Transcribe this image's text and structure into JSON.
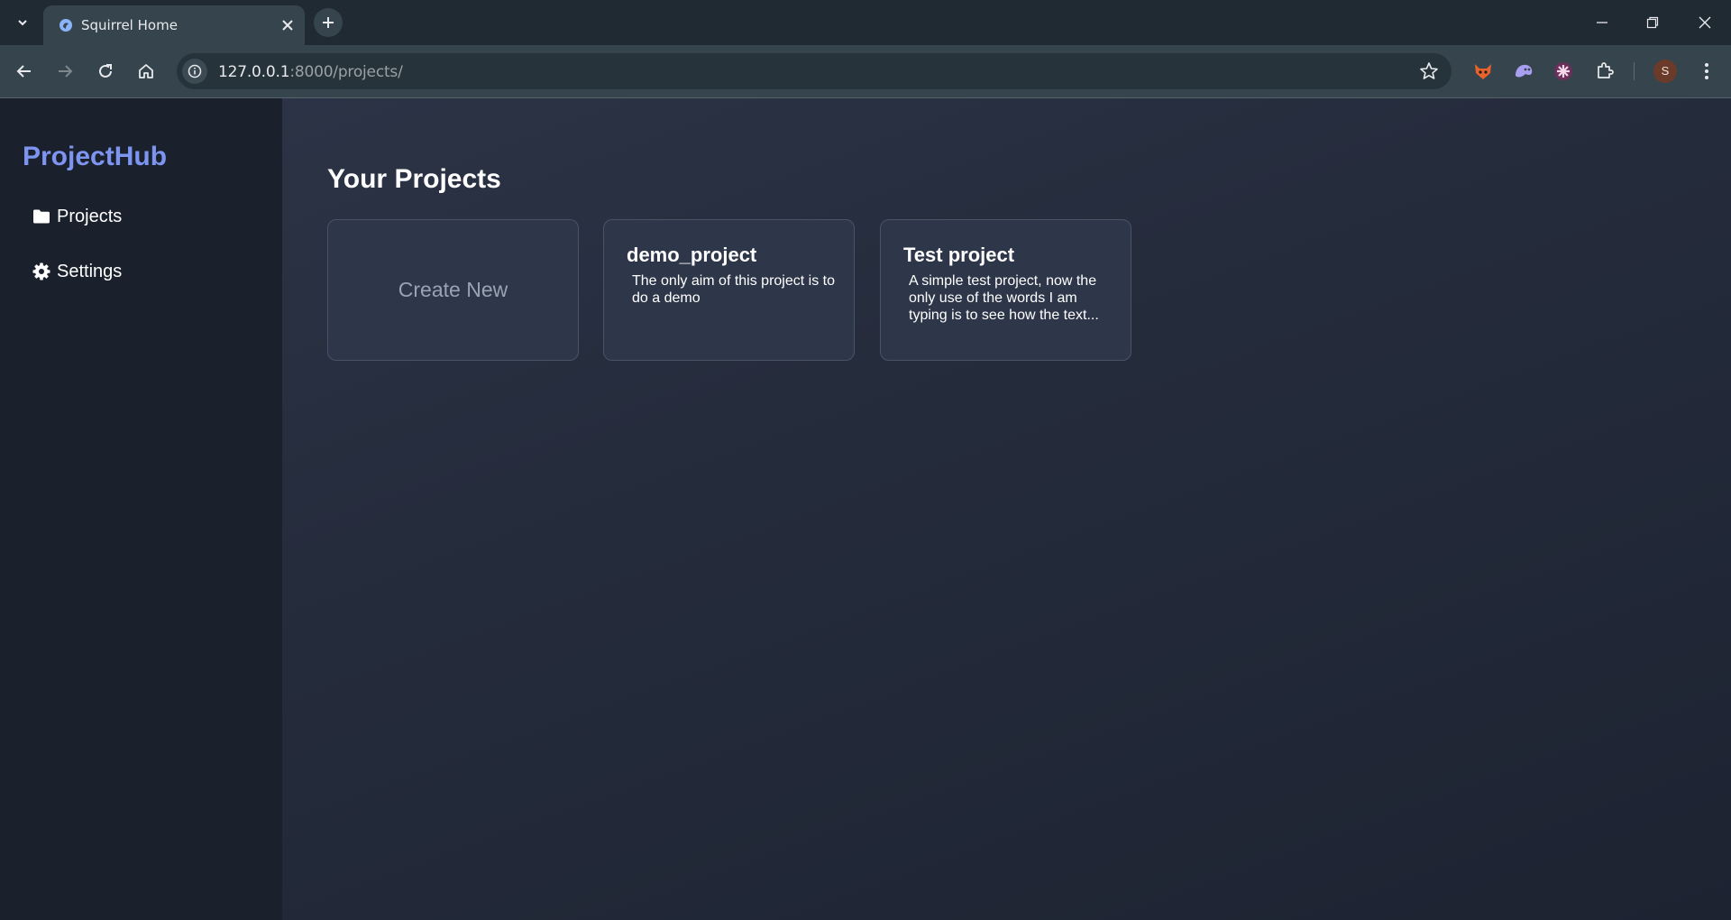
{
  "browser": {
    "tab_title": "Squirrel Home",
    "url_host": "127.0.0.1",
    "url_path": ":8000/projects/",
    "avatar_letter": "S"
  },
  "sidebar": {
    "brand": "ProjectHub",
    "items": [
      {
        "label": "Projects",
        "icon": "folder-icon"
      },
      {
        "label": "Settings",
        "icon": "gear-icon"
      }
    ]
  },
  "main": {
    "heading": "Your Projects",
    "create_label": "Create New",
    "projects": [
      {
        "title": "demo_project",
        "description": "The only aim of this project is to do a demo"
      },
      {
        "title": "Test project",
        "description": "A simple test project, now the only use of the words I am typing is to see how the text..."
      }
    ]
  },
  "colors": {
    "brand": "#7d95f0",
    "sidebar_bg": "#1b212c",
    "card_bg": "#2e3649"
  }
}
